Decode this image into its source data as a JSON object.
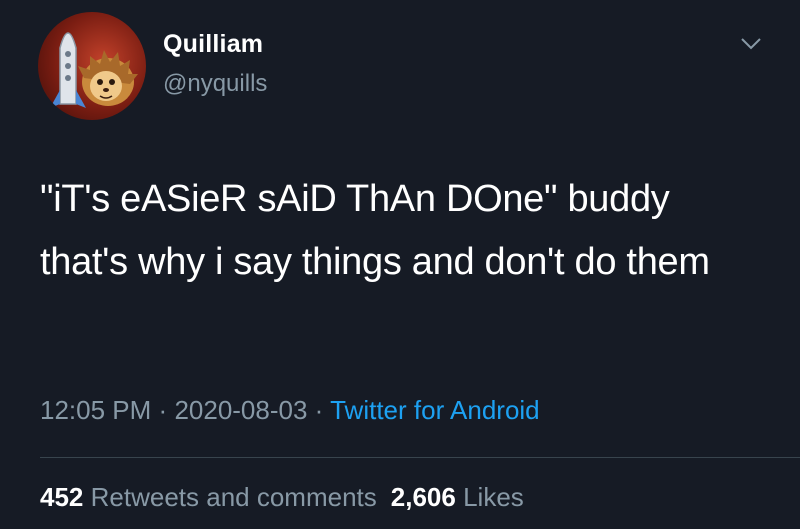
{
  "user": {
    "display_name": "Quilliam",
    "handle": "@nyquills",
    "avatar_icon": "rocket-hedgehog-avatar"
  },
  "tweet": {
    "text": "\"iT's eASieR sAiD ThAn DOne\" buddy that's why i say things and don't do them",
    "time": "12:05 PM",
    "date": "2020-08-03",
    "separator": "·",
    "client": "Twitter for Android"
  },
  "stats": {
    "retweets_count": "452",
    "retweets_label": "Retweets and comments",
    "likes_count": "2,606",
    "likes_label": "Likes"
  },
  "icons": {
    "menu": "chevron-down-icon"
  },
  "colors": {
    "background": "#161b25",
    "handle": "#8899a6",
    "link": "#1da1f2",
    "divider": "#38444d"
  }
}
